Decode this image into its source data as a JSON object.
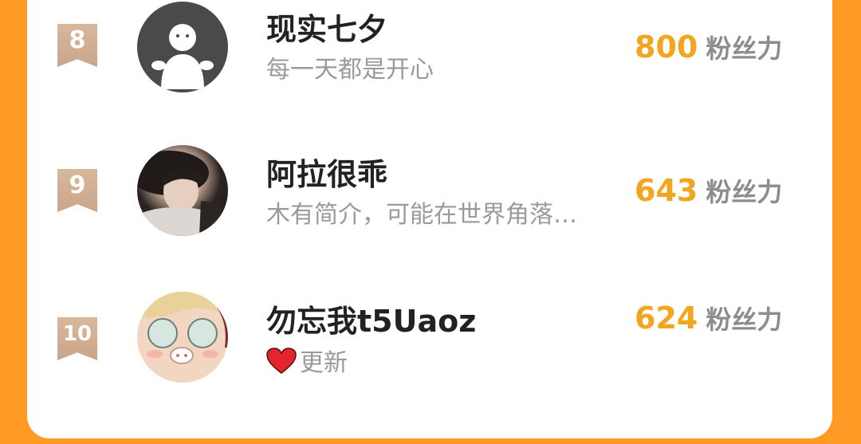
{
  "leaderboard": {
    "unit_label": "粉丝力",
    "entries": [
      {
        "rank": "8",
        "name": "现实七夕",
        "bio": "每一天都是开心",
        "score": "800",
        "avatar": "default-avatar-icon"
      },
      {
        "rank": "9",
        "name": "阿拉很乖",
        "bio": "木有简介，可能在世界角落…",
        "score": "643",
        "avatar": "photo-avatar"
      },
      {
        "rank": "10",
        "name": "勿忘我t5Uaoz",
        "bio": "更新",
        "bio_icon": "red-heart-icon",
        "score": "624",
        "avatar": "cartoon-avatar"
      }
    ]
  },
  "colors": {
    "background": "#ff9a24",
    "card": "#ffffff",
    "score": "#f2a51e",
    "badge": "#d1ae92",
    "name": "#222222",
    "bio": "#9a9a9a"
  }
}
